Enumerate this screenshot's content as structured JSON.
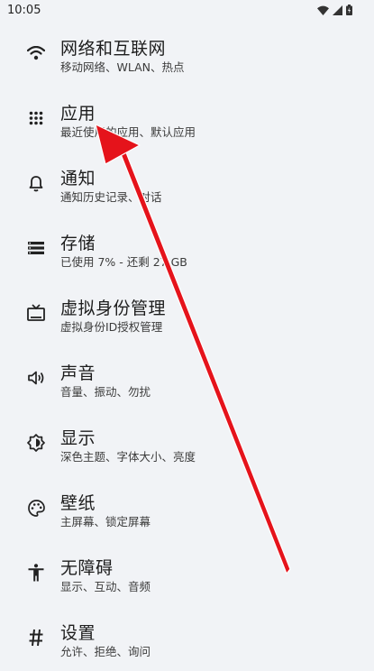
{
  "status": {
    "time": "10:05"
  },
  "settings": {
    "items": [
      {
        "title": "网络和互联网",
        "subtitle": "移动网络、WLAN、热点",
        "icon": "wifi-icon"
      },
      {
        "title": "应用",
        "subtitle": "最近使用的应用、默认应用",
        "icon": "apps-grid-icon"
      },
      {
        "title": "通知",
        "subtitle": "通知历史记录、对话",
        "icon": "bell-icon"
      },
      {
        "title": "存储",
        "subtitle": "已使用 7% - 还剩 27 GB",
        "icon": "storage-icon"
      },
      {
        "title": "虚拟身份管理",
        "subtitle": "虚拟身份ID授权管理",
        "icon": "tv-icon"
      },
      {
        "title": "声音",
        "subtitle": "音量、振动、勿扰",
        "icon": "volume-icon"
      },
      {
        "title": "显示",
        "subtitle": "深色主题、字体大小、亮度",
        "icon": "brightness-icon"
      },
      {
        "title": "壁纸",
        "subtitle": "主屏幕、锁定屏幕",
        "icon": "palette-icon"
      },
      {
        "title": "无障碍",
        "subtitle": "显示、互动、音频",
        "icon": "accessibility-icon"
      },
      {
        "title": "设置",
        "subtitle": "允许、拒绝、询问",
        "icon": "hash-icon"
      }
    ]
  },
  "annotation": {
    "arrow_color": "#e5131b"
  }
}
